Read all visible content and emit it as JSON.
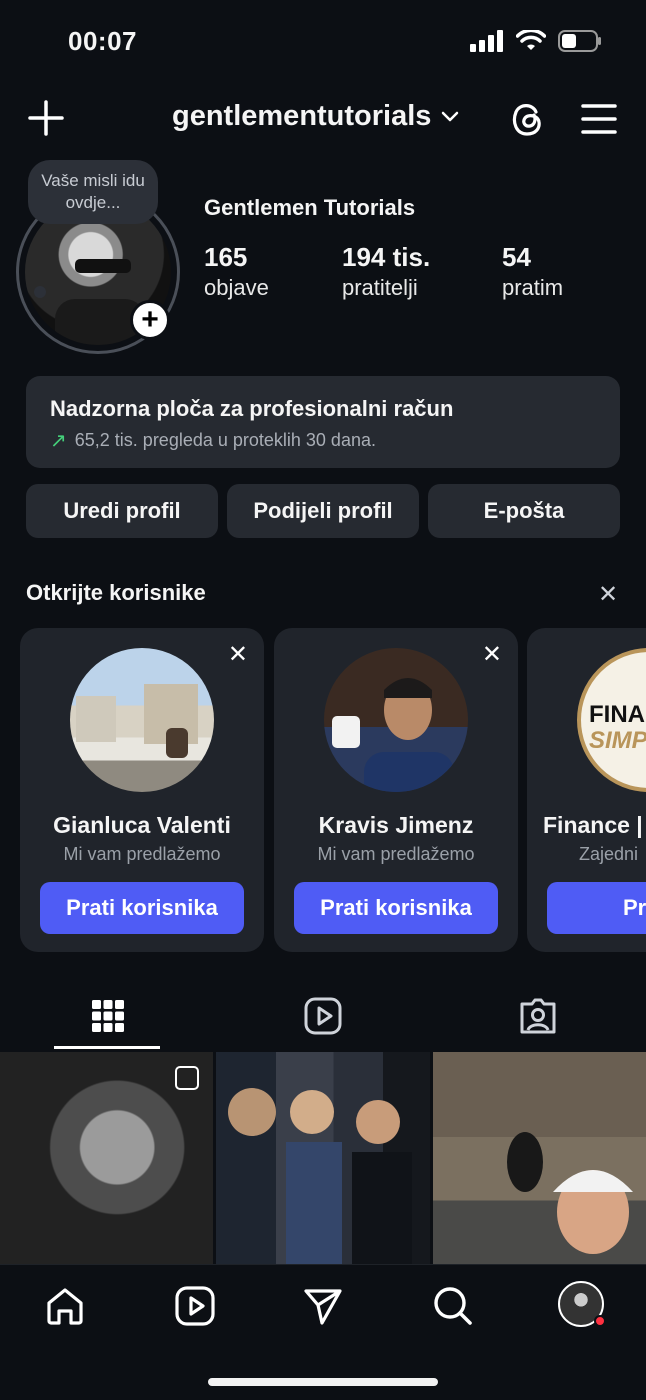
{
  "status_bar": {
    "time": "00:07"
  },
  "header": {
    "username": "gentlementutorials"
  },
  "profile": {
    "note": "Vaše misli idu ovdje...",
    "display_name": "Gentlemen Tutorials",
    "stats": [
      {
        "value": "165",
        "label": "objave"
      },
      {
        "value": "194 tis.",
        "label": "pratitelji"
      },
      {
        "value": "54",
        "label": "pratim"
      }
    ]
  },
  "dashboard": {
    "title": "Nadzorna ploča za profesionalni račun",
    "subtitle": "65,2 tis. pregleda u proteklih 30 dana."
  },
  "buttons": {
    "edit": "Uredi profil",
    "share": "Podijeli profil",
    "email": "E-pošta"
  },
  "discover": {
    "title": "Otkrijte korisnike",
    "cards": [
      {
        "name": "Gianluca Valenti",
        "subtitle": "Mi vam predlažemo",
        "button": "Prati korisnika"
      },
      {
        "name": "Kravis Jimenz",
        "subtitle": "Mi vam predlažemo",
        "button": "Prati korisnika"
      },
      {
        "name": "Finance | ",
        "subtitle": "Zajedni",
        "button": "Pr",
        "logo_line1": "FINAN",
        "logo_line2": "SIMP"
      }
    ]
  },
  "colors": {
    "background": "#0c0f14",
    "card": "#20242b",
    "accent_button": "#4f5cf5",
    "trend_up": "#44d07a",
    "notification": "#ff3040"
  }
}
